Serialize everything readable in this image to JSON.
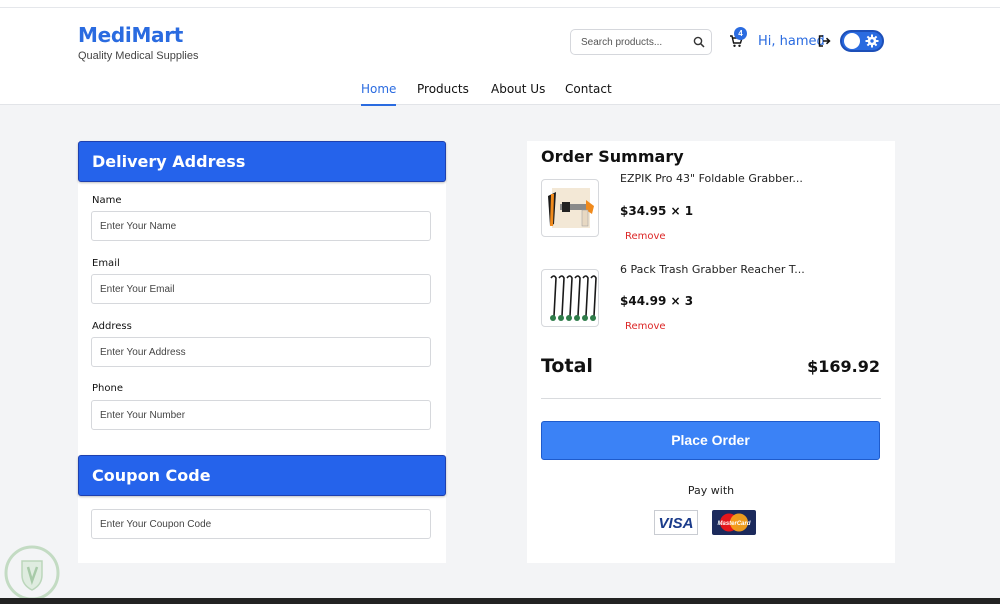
{
  "brand": {
    "name": "MediMart",
    "tagline": "Quality Medical Supplies",
    "color": "#2a6be0"
  },
  "header": {
    "search_placeholder": "Search products...",
    "cart_count": "4",
    "greeting": "Hi, hamed"
  },
  "nav": {
    "items": [
      {
        "label": "Home",
        "active": true
      },
      {
        "label": "Products",
        "active": false
      },
      {
        "label": "About Us",
        "active": false
      },
      {
        "label": "Contact",
        "active": false
      }
    ]
  },
  "delivery": {
    "title": "Delivery Address",
    "fields": [
      {
        "label": "Name",
        "placeholder": "Enter Your Name",
        "value": ""
      },
      {
        "label": "Email",
        "placeholder": "Enter Your Email",
        "value": ""
      },
      {
        "label": "Address",
        "placeholder": "Enter Your Address",
        "value": ""
      },
      {
        "label": "Phone",
        "placeholder": "Enter Your Number",
        "value": ""
      }
    ]
  },
  "coupon": {
    "title": "Coupon Code",
    "placeholder": "Enter Your Coupon Code",
    "value": ""
  },
  "summary": {
    "title": "Order Summary",
    "items": [
      {
        "name": "EZPIK Pro 43\" Foldable Grabber...",
        "price": "$34.95 × 1",
        "remove_label": "Remove",
        "icon": "grabber-image"
      },
      {
        "name": "6 Pack Trash Grabber Reacher T...",
        "price": "$44.99 × 3",
        "remove_label": "Remove",
        "icon": "grabber-pack-image"
      }
    ],
    "total_label": "Total",
    "total_value": "$169.92",
    "place_order_label": "Place Order",
    "pay_with_label": "Pay with",
    "payment_methods": [
      "VISA",
      "MasterCard"
    ]
  },
  "colors": {
    "accent": "#2563eb",
    "button": "#3b82f6",
    "remove": "#dc2626",
    "background": "#f3f4f6"
  }
}
